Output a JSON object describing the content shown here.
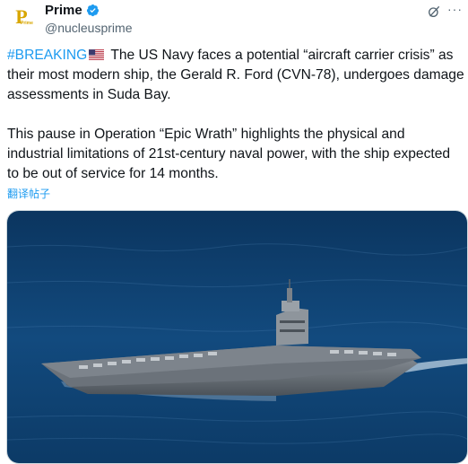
{
  "account": {
    "name": "Prime",
    "handle": "@nucleusprime",
    "avatar_letter": "P",
    "avatar_subtext": "Prime",
    "verified": true
  },
  "post": {
    "hashtag": "#BREAKING",
    "paragraph1_text": " The US Navy faces a potential “aircraft carrier crisis” as their most modern ship, the Gerald R. Ford (CVN-78), undergoes damage assessments in Suda Bay.",
    "paragraph2_text": "This pause in Operation “Epic Wrath” highlights the physical and industrial limitations of 21st-century naval power, with the ship expected to be out of service for 14 months.",
    "translate_label": "翻译帖子"
  },
  "icons": {
    "verified": "verified-badge-icon",
    "grok": "grok-icon",
    "more": "more-icon",
    "flag": "us-flag-icon"
  },
  "colors": {
    "link": "#1d9bf0",
    "text": "#0f1419",
    "secondary": "#536471",
    "avatar_gold": "#d8a600",
    "sea": "#0f3f6e"
  }
}
